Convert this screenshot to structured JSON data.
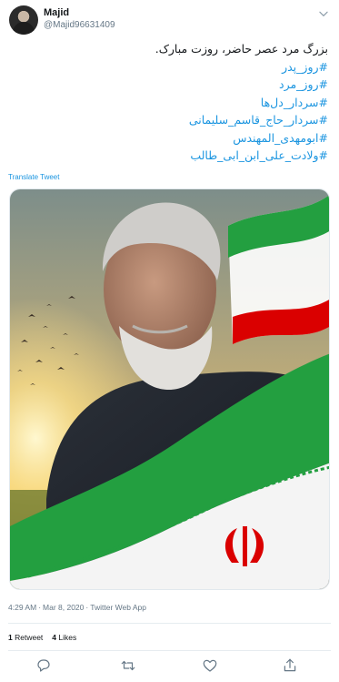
{
  "user": {
    "name": "Majid",
    "handle": "@Majid96631409"
  },
  "tweet": {
    "lines": [
      {
        "text": "بزرگ مرد عصر حاضر، روزت مبارک.",
        "kind": "plain"
      },
      {
        "text": "#روز_پدر",
        "kind": "tag"
      },
      {
        "text": "#روز_مرد",
        "kind": "tag"
      },
      {
        "text": "#سردار_دل‌ها",
        "kind": "tag"
      },
      {
        "text": "#سردار_حاج_قاسم_سلیمانی",
        "kind": "tag"
      },
      {
        "text": "#ابومهدی_المهندس",
        "kind": "tag"
      },
      {
        "text": "#ولادت_علی_ابن_ابی_طالب",
        "kind": "tag"
      }
    ],
    "translate": "Translate Tweet"
  },
  "meta": {
    "time": "4:29 AM",
    "date": "Mar 8, 2020",
    "separator": "·",
    "source": "Twitter Web App"
  },
  "stats": {
    "retweets": "1",
    "retweets_label": "Retweet",
    "likes": "4",
    "likes_label": "Likes"
  },
  "icons": {
    "caret": "chevron-down-icon",
    "reply": "reply-icon",
    "retweet": "retweet-icon",
    "like": "heart-icon",
    "share": "share-icon"
  },
  "colors": {
    "link": "#1b95e0",
    "text": "#14171a",
    "muted": "#657786",
    "flag_green": "#239f40",
    "flag_red": "#da0000"
  }
}
